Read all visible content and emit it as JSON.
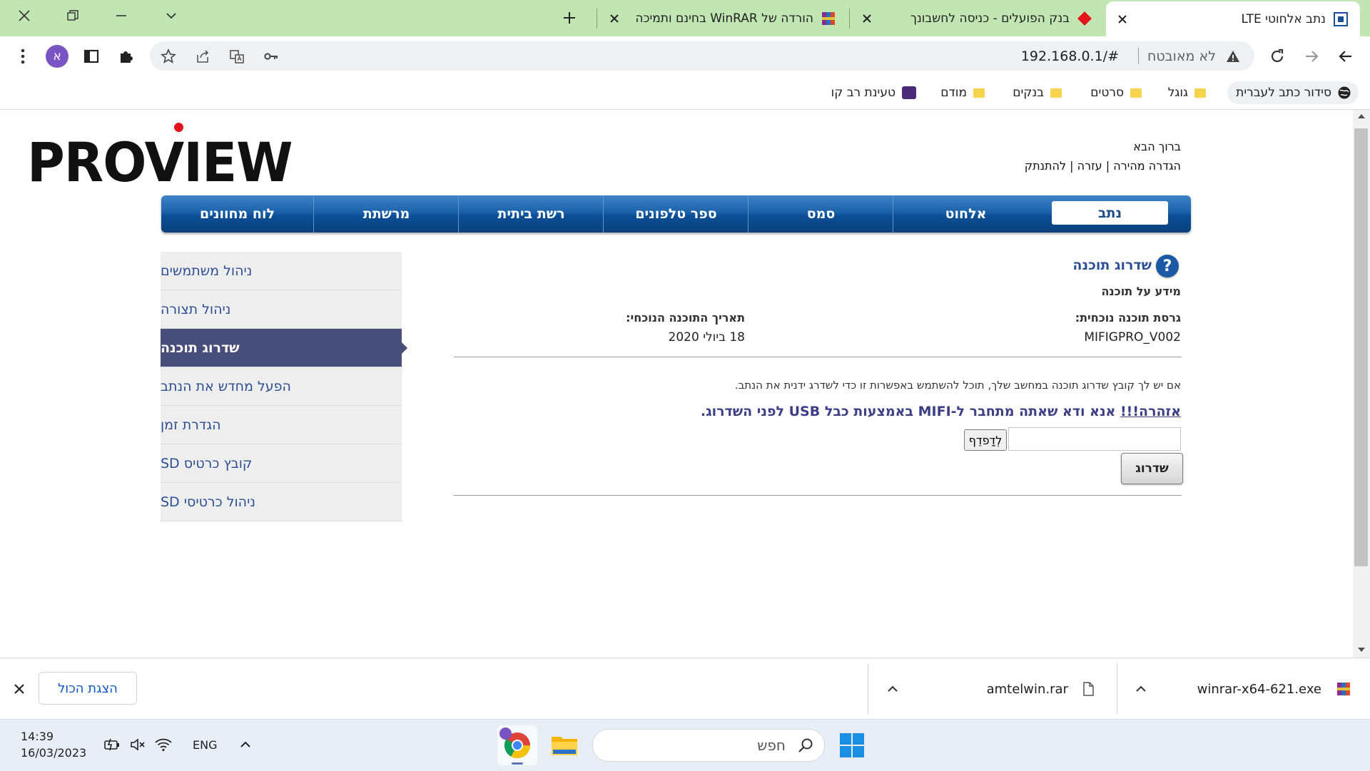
{
  "browser": {
    "tabs": [
      {
        "title": "נתב אלחוטי LTE",
        "active": true
      },
      {
        "title": "בנק הפועלים - כניסה לחשבונך",
        "active": false
      },
      {
        "title": "הורדה של WinRAR בחינם ותמיכה",
        "active": false
      }
    ],
    "address": {
      "security": "לא מאובטח",
      "url": "192.168.0.1/#"
    },
    "profile_initial": "א",
    "bookmarks": [
      {
        "label": "סידור כתב לעברית",
        "icon": "globe-icon"
      },
      {
        "label": "גוגל",
        "icon": "folder-icon"
      },
      {
        "label": "סרטים",
        "icon": "folder-icon"
      },
      {
        "label": "בנקים",
        "icon": "folder-icon"
      },
      {
        "label": "מודם",
        "icon": "folder-icon"
      },
      {
        "label": "טעינת רב קו",
        "icon": "app-icon"
      }
    ]
  },
  "site": {
    "logo_text": "PROVIEW",
    "welcome": "ברוך הבא",
    "links": {
      "quick_setup": "הגדרה מהירה",
      "help": "עזרה",
      "logout": "להתנתק",
      "sep": "|"
    },
    "nav": [
      "נתב",
      "אלחוט",
      "סמס",
      "ספר טלפונים",
      "רשת ביתית",
      "מרשתת",
      "לוח מחוונים"
    ],
    "side_menu": [
      {
        "label": "ניהול משתמשים",
        "active": false
      },
      {
        "label": "ניהול תצורה",
        "active": false
      },
      {
        "label": "שדרוג תוכנה",
        "active": true
      },
      {
        "label": "הפעל מחדש את הנתב",
        "active": false
      },
      {
        "label": "הגדרת זמן",
        "active": false
      },
      {
        "label": "קובץ כרטיס SD",
        "active": false
      },
      {
        "label": "ניהול כרטיסי SD",
        "active": false
      }
    ],
    "content": {
      "help_icon": "?",
      "title": "שדרוג תוכנה",
      "section": "מידע על תוכנה",
      "current_version_label": "גרסת תוכנה נוכחית:",
      "current_version_value": "MIFIGPRO_V002",
      "current_date_label": "תאריך התוכנה הנוכחי:",
      "current_date_value": "18 ביולי 2020",
      "instruction": "אם יש לך קובץ שדרוג תוכנה במחשב שלך, תוכל להשתמש באפשרות זו כדי לשדרג ידנית את הנתב.",
      "warning_prefix": "אזהרה!!!",
      "warning_rest": " אנא ודא שאתה מתחבר ל-MIFI באמצעות כבל USB לפני השדרוג.",
      "browse_label": "לְדַפדֵף",
      "upgrade_label": "שדרוג",
      "warning_color": "#3d3f86",
      "link_color": "#2d4f94"
    }
  },
  "downloads": {
    "items": [
      {
        "name": "winrar-x64-621.exe"
      },
      {
        "name": "amtelwin.rar"
      }
    ],
    "show_all": "הצגת הכול"
  },
  "taskbar": {
    "time": "14:39",
    "date": "16/03/2023",
    "lang": "ENG",
    "search_placeholder": "חפש"
  }
}
